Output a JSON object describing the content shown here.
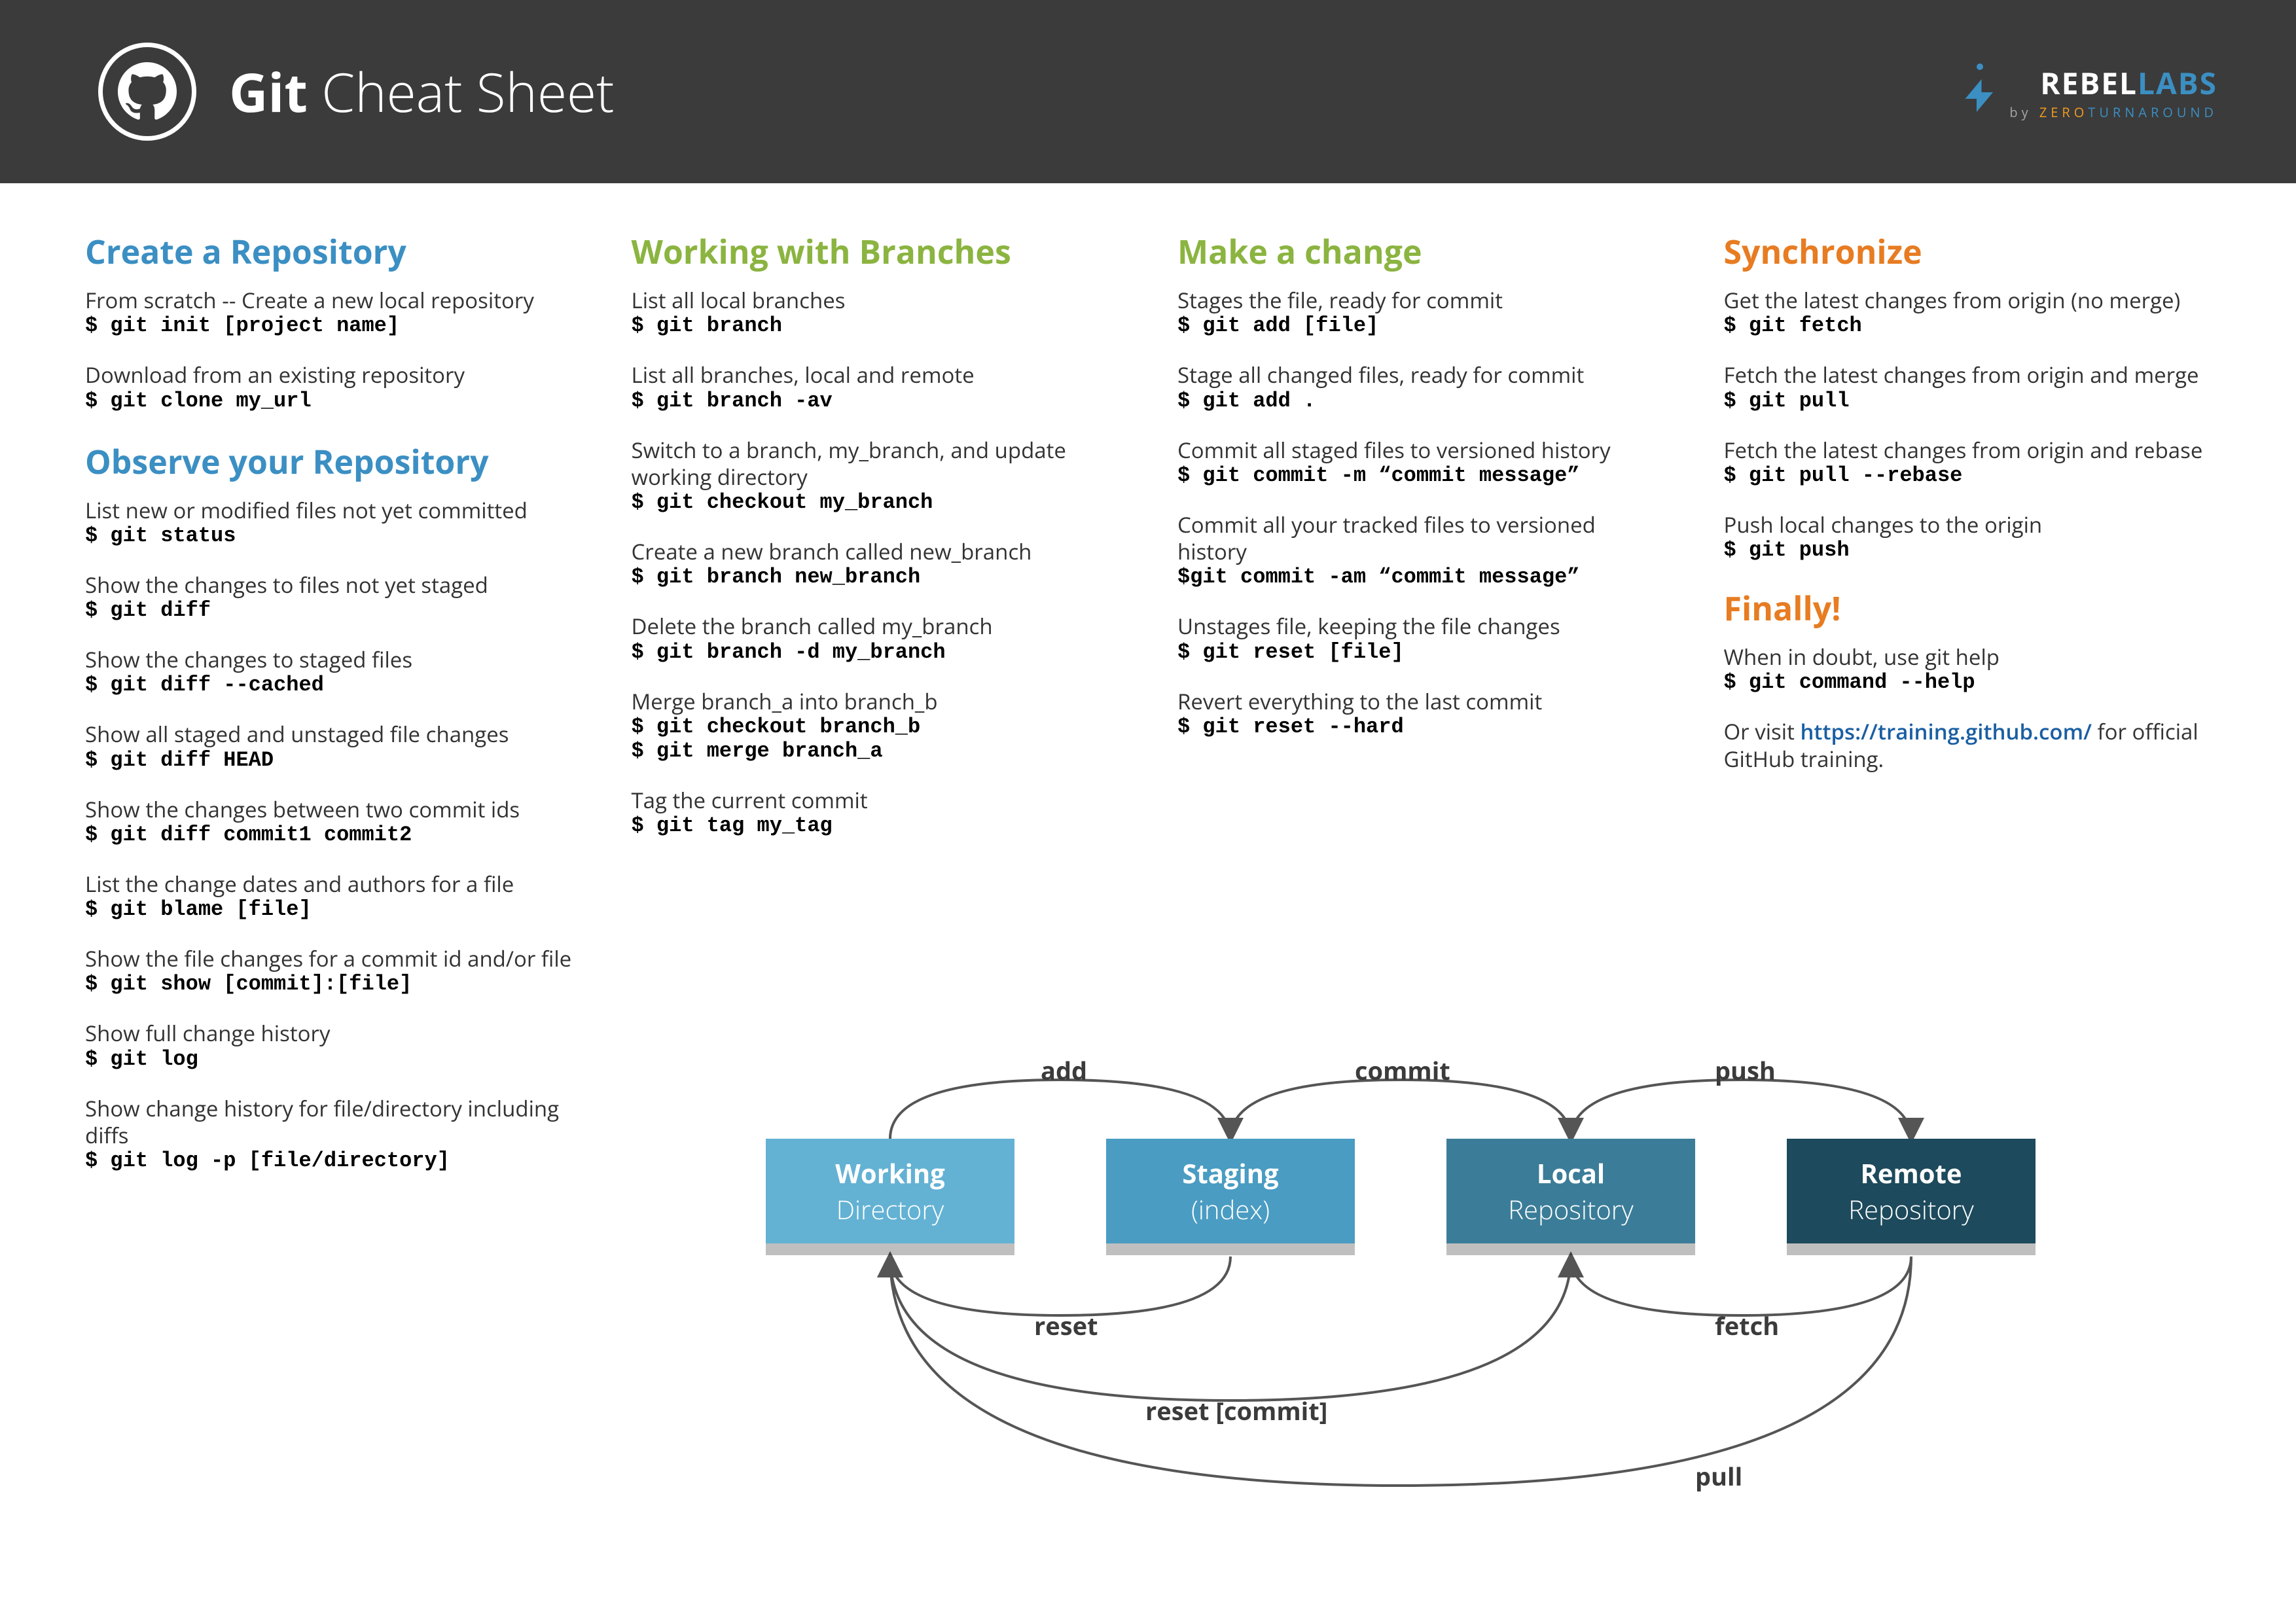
{
  "header": {
    "title_bold": "Git",
    "title_rest": " Cheat Sheet",
    "brand_top_1": "REBEL",
    "brand_top_2": "LABS",
    "brand_bottom_by": "by ",
    "brand_bottom_zero": "ZERO",
    "brand_bottom_turn": "TURNAROUND"
  },
  "col1": {
    "s1_title": "Create a Repository",
    "s1": [
      {
        "d": "From scratch -- Create a new local repository",
        "c": "$ git init [project name]"
      },
      {
        "d": "Download from an existing repository",
        "c": "$ git clone my_url"
      }
    ],
    "s2_title": "Observe your Repository",
    "s2": [
      {
        "d": "List new or modified files not yet committed",
        "c": "$ git status"
      },
      {
        "d": "Show the changes to files not yet staged",
        "c": "$ git diff"
      },
      {
        "d": "Show the changes to staged files",
        "c": "$ git diff --cached"
      },
      {
        "d": "Show all staged and unstaged file changes",
        "c": "$ git diff HEAD"
      },
      {
        "d": "Show the changes between two commit ids",
        "c": "$ git diff commit1 commit2"
      },
      {
        "d": "List the change dates and authors for a file",
        "c": "$ git blame [file]"
      },
      {
        "d": "Show the file changes for a commit id and/or file",
        "c": "$ git show [commit]:[file]"
      },
      {
        "d": "Show full change history",
        "c": "$ git log"
      },
      {
        "d": "Show change history for file/directory including diffs",
        "c": "$ git log -p [file/directory]"
      }
    ]
  },
  "col2": {
    "s1_title": "Working with Branches",
    "s1": [
      {
        "d": "List all local branches",
        "c": "$ git branch"
      },
      {
        "d": "List all branches, local and remote",
        "c": "$ git branch -av"
      },
      {
        "d": "Switch to a branch, my_branch, and update working directory",
        "c": "$ git checkout my_branch"
      },
      {
        "d": "Create a new branch called new_branch",
        "c": "$ git branch new_branch"
      },
      {
        "d": "Delete the branch called my_branch",
        "c": "$ git branch -d my_branch"
      },
      {
        "d": "Merge branch_a into branch_b",
        "c": "$ git checkout branch_b\n$ git merge branch_a"
      },
      {
        "d": "Tag the current commit",
        "c": "$ git tag my_tag"
      }
    ]
  },
  "col3": {
    "s1_title": "Make a change",
    "s1": [
      {
        "d": "Stages the file, ready for commit",
        "c": "$ git add [file]"
      },
      {
        "d": "Stage all changed files, ready for commit",
        "c": "$ git add ."
      },
      {
        "d": "Commit all staged files to versioned history",
        "c": "$ git commit -m “commit message”"
      },
      {
        "d": "Commit all your tracked files to versioned history",
        "c": "$git commit -am “commit message”"
      },
      {
        "d": "Unstages file, keeping the file changes",
        "c": "$ git reset [file]"
      },
      {
        "d": "Revert everything to the last commit",
        "c": "$ git reset --hard"
      }
    ]
  },
  "col4": {
    "s1_title": "Synchronize",
    "s1": [
      {
        "d": "Get the latest changes from origin (no merge)",
        "c": "$ git fetch"
      },
      {
        "d": "Fetch the latest changes from origin and merge",
        "c": "$ git pull"
      },
      {
        "d": "Fetch the latest changes from origin and rebase",
        "c": "$ git pull --rebase"
      },
      {
        "d": "Push local changes to the origin",
        "c": "$ git push"
      }
    ],
    "s2_title": "Finally!",
    "s2_d1": "When in doubt, use git help",
    "s2_c1": "$ git command --help",
    "s2_d2_a": "Or visit ",
    "s2_d2_link": "https://training.github.com/",
    "s2_d2_b": " for official GitHub training."
  },
  "diagram": {
    "boxes": {
      "wd": {
        "t1": "Working",
        "t2": "Directory"
      },
      "st": {
        "t1": "Staging",
        "t2": "(index)"
      },
      "lc": {
        "t1": "Local",
        "t2": "Repository"
      },
      "rm": {
        "t1": "Remote",
        "t2": "Repository"
      }
    },
    "labels": {
      "add": "add",
      "commit": "commit",
      "push": "push",
      "reset": "reset",
      "fetch": "fetch",
      "reset_commit": "reset [commit]",
      "pull": "pull"
    }
  }
}
